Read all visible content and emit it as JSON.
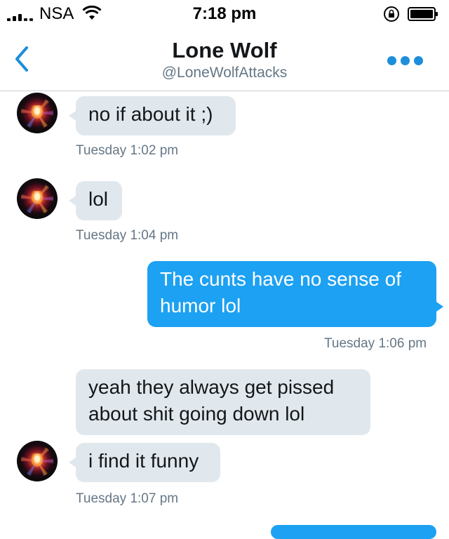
{
  "status_bar": {
    "carrier": "NSA",
    "time": "7:18 pm"
  },
  "header": {
    "title": "Lone Wolf",
    "handle": "@LoneWolfAttacks"
  },
  "messages": [
    {
      "direction": "in",
      "text": "no if about it ;)"
    },
    {
      "direction": "in",
      "text": "lol"
    },
    {
      "direction": "out",
      "text_lines": [
        "The cunts have no sense of",
        "humor lol"
      ]
    },
    {
      "direction": "in",
      "text_lines": [
        "yeah they always get pissed",
        "about shit going down lol"
      ]
    },
    {
      "direction": "in",
      "text": "i find it funny"
    }
  ],
  "timestamps": [
    "Tuesday 1:02 pm",
    "Tuesday 1:04 pm",
    "Tuesday 1:06 pm",
    "Tuesday 1:07 pm"
  ],
  "colors": {
    "accent": "#1d8edc",
    "outgoing_bubble": "#1da1f2",
    "incoming_bubble": "#e1e8ed",
    "secondary_text": "#657786"
  },
  "icons": {
    "back": "chevron-left-icon",
    "more": "more-dots-icon",
    "wifi": "wifi-icon",
    "rotation_lock": "rotation-lock-icon",
    "battery": "battery-icon"
  }
}
